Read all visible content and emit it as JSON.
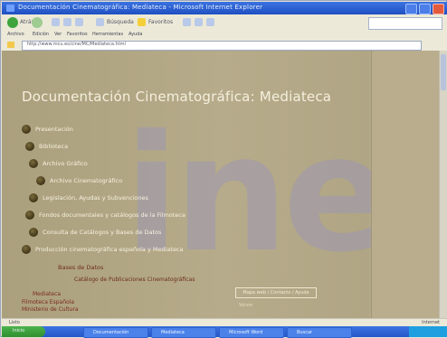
{
  "window": {
    "title": "Documentación Cinematográfica: Mediateca - Microsoft Internet Explorer"
  },
  "menu": [
    "Archivo",
    "Edición",
    "Ver",
    "Favoritos",
    "Herramientas",
    "Ayuda"
  ],
  "toolbar": {
    "back_label": "Atrás",
    "search_label": "Búsqueda",
    "favorites_label": "Favoritos"
  },
  "address": {
    "url": "http://www.mcu.es/cine/MC/Mediateca.html"
  },
  "page": {
    "title": "Documentación Cinematográfica: Mediateca",
    "nav": [
      "Presentación",
      "Biblioteca",
      "Archivo Gráfico",
      "Archivo Cinematográfico",
      "Legislación, Ayudas y Subvenciones",
      "Fondos documentales y catálogos de la Filmoteca",
      "Consulta de Catálogos y Bases de Datos",
      "Producción cinematográfica española y Mediateca"
    ],
    "sub_heading": "Bases de Datos",
    "sub_link": "Catálogo de Publicaciones Cinematográficas",
    "footer": [
      "Mediateca",
      "Filmoteca Española",
      "Ministerio de Cultura"
    ],
    "button_label": "Mapa web / Contacto / Ayuda",
    "small_link": "Volver"
  },
  "watermark": {
    "text": "ine"
  },
  "status": {
    "left": "Listo",
    "right": "Internet"
  },
  "taskbar": {
    "start_label": "Inicio",
    "items": [
      "Documentación",
      "Mediateca",
      "Microsoft Word",
      "Buscar"
    ]
  },
  "colors": {
    "page_bg": "#b3a889",
    "title_bar": "#2d5fd1",
    "link": "#6b2b1c"
  }
}
